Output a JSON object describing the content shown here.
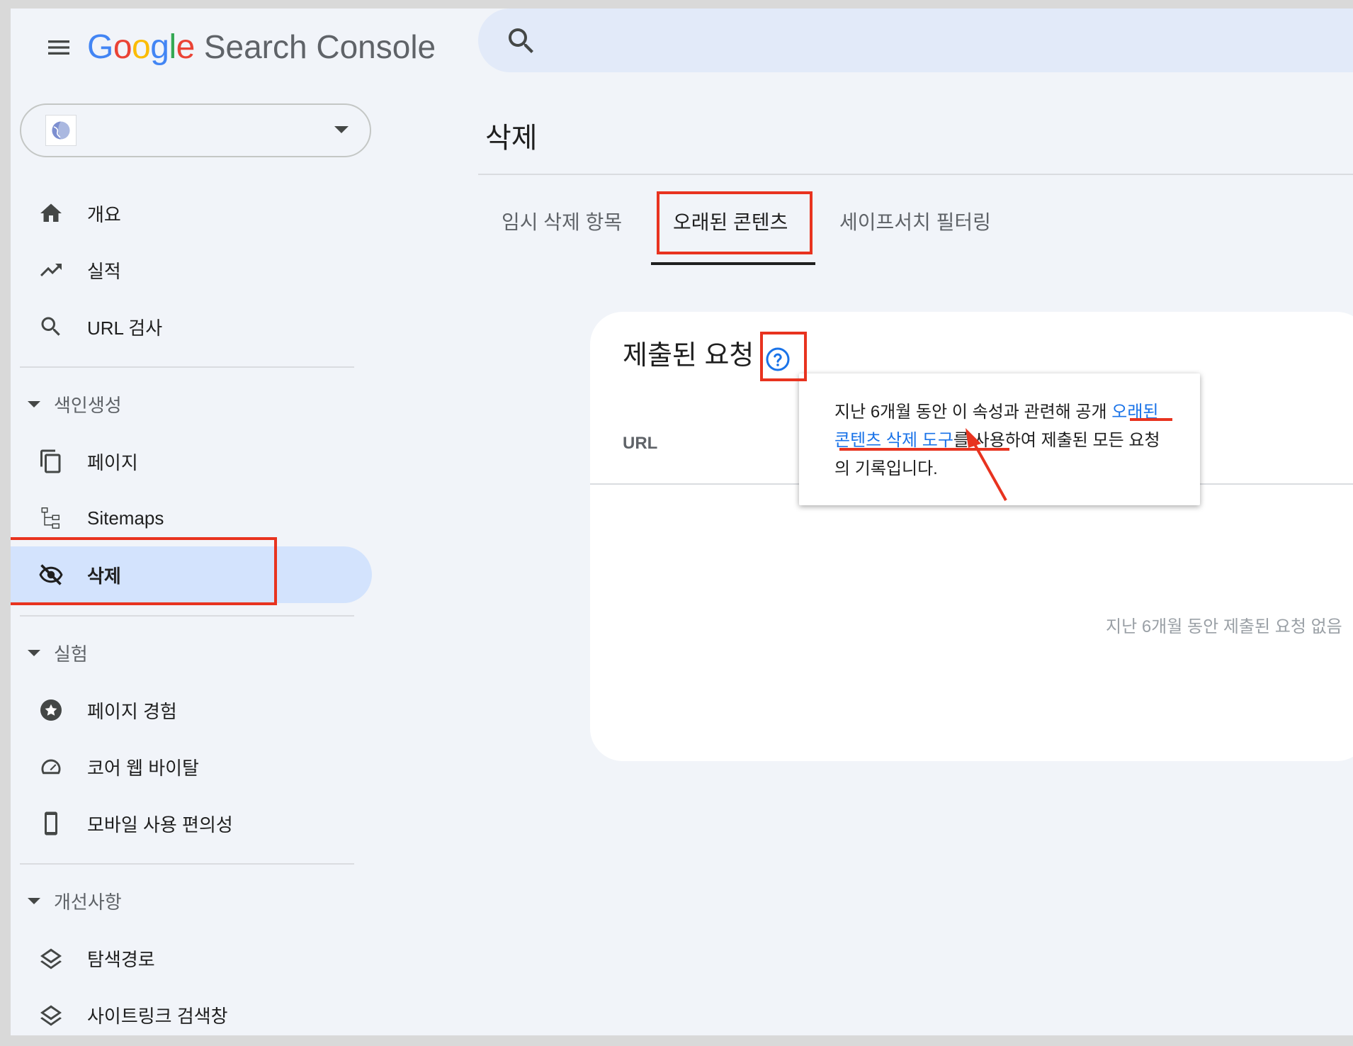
{
  "header": {
    "logo_google": "Google",
    "logo_product": "Search Console",
    "menu_icon": "hamburger-menu-icon",
    "search_icon": "search-icon"
  },
  "property_selector": {
    "favicon": "globe-icon",
    "caret": "dropdown-caret-icon"
  },
  "sidebar": {
    "items": [
      {
        "label": "개요",
        "icon": "home-icon"
      },
      {
        "label": "실적",
        "icon": "trending-up-icon"
      },
      {
        "label": "URL 검사",
        "icon": "search-icon"
      }
    ],
    "sections": [
      {
        "title": "색인생성",
        "items": [
          {
            "label": "페이지",
            "icon": "copy-pages-icon"
          },
          {
            "label": "Sitemaps",
            "icon": "sitemap-icon"
          },
          {
            "label": "삭제",
            "icon": "eye-off-icon",
            "active": true
          }
        ]
      },
      {
        "title": "실험",
        "items": [
          {
            "label": "페이지 경험",
            "icon": "star-badge-icon"
          },
          {
            "label": "코어 웹 바이탈",
            "icon": "speedometer-icon"
          },
          {
            "label": "모바일 사용 편의성",
            "icon": "smartphone-icon"
          }
        ]
      },
      {
        "title": "개선사항",
        "items": [
          {
            "label": "탐색경로",
            "icon": "layers-icon"
          },
          {
            "label": "사이트링크 검색창",
            "icon": "layers-icon"
          }
        ]
      }
    ]
  },
  "main": {
    "title": "삭제",
    "tabs": [
      {
        "label": "임시 삭제 항목",
        "active": false
      },
      {
        "label": "오래된 콘텐츠",
        "active": true
      },
      {
        "label": "세이프서치 필터링",
        "active": false
      }
    ],
    "card": {
      "title": "제출된 요청",
      "help_icon": "help-circle-icon",
      "column_url": "URL",
      "empty_message": "지난 6개월 동안 제출된 요청 없음"
    },
    "tooltip": {
      "text_before": "지난 6개월 동안 이 속성과 관련해 공개 ",
      "link": "오래된 콘텐츠 삭제 도구",
      "text_after": "를 사용하여 제출된 모든 요청의 기록입니다."
    }
  },
  "colors": {
    "accent_blue": "#1a73e8",
    "active_nav_bg": "#d3e3fd",
    "annotation_red": "#e8331f",
    "background": "#f1f4f9"
  }
}
